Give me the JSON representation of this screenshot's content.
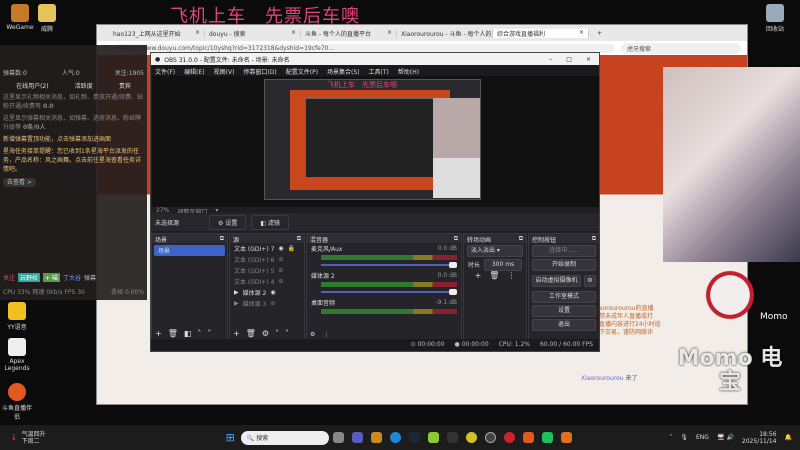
{
  "desktop": {
    "banner": "飞机上车　先票后车噢",
    "icons": [
      "WeGame",
      "威腾",
      "回收站",
      "YY语音",
      "Apex Legends",
      "斗鱼直播伴侣"
    ]
  },
  "browser": {
    "tabs": [
      "hao123_上网从这里开始",
      "douyu - 搜索",
      "斗鱼 - 每个人的直播平台",
      "Xiaorourourou - 斗鱼 - 每个人的直播平台",
      "综合游戏直播福利"
    ],
    "url": "https://www.douyu.com/topic/10yshq?rid=3172318&dyshid=19cfe70...",
    "search": "虎牙搜索",
    "chat_system": "欢迎来到Xiaorourourou的直播间。斗鱼严禁未成年人直播或打赏，依法对直播内容进行24小时巡查。请勿私下交易，谨防网络诈骗。",
    "chat_user": "Xiaorourourou",
    "chat_action": "来了"
  },
  "sidepanel": {
    "stats": [
      "弹幕数:0",
      "人气:0",
      "关注:1905"
    ],
    "tabs": [
      "在线用户(2)",
      "活跃度",
      "贵宾"
    ],
    "msg1": "这里显示礼物相关消息，如礼物、贵族开通/续费、钻粉开通/续费等",
    "count1": "0.0",
    "msg2": "这里显示弹幕相关消息，如弹幕、进房消息、粉丝牌升级等",
    "count2": "0条/0人",
    "notice1": "新增弹幕置顶功能，点击弹幕添加进画面",
    "notice2": "星海任务接单提醒：您已收到1条星海平台派发的任务，产品名称：风之画舞。点击前往星海查看任务详情吧。",
    "go": "去查看 >",
    "tags": [
      "关注",
      "玩野校",
      "+ 喵",
      "丁大谷",
      "弹幕"
    ],
    "perf": "CPU 33%  网速 0kb/s  FPS 30",
    "loss": "丢帧 0.00%"
  },
  "obs": {
    "title": "OBS 31.0.0 - 配置文件: 未命名 - 场景: 未命名",
    "menu": [
      "文件(F)",
      "编辑(E)",
      "视图(V)",
      "停靠窗口(D)",
      "配置文件(P)",
      "场景集合(S)",
      "工具(T)",
      "帮助(H)"
    ],
    "zoom": "27%",
    "zoom_mode": "调整至窗口",
    "no_source": "未选择源",
    "settings_btn": "设置",
    "filters_btn": "滤镜",
    "scenes_title": "场景",
    "scenes": [
      "场景"
    ],
    "sources_title": "源",
    "sources": [
      "文本 (GDI+) 7",
      "文本 (GDI+) 6",
      "文本 (GDI+) 5",
      "文本 (GDI+) 4",
      "媒体源 2",
      "媒体源 3"
    ],
    "mixer_title": "混音器",
    "mixer": [
      {
        "name": "麦克风/Aux",
        "db": "0.0 dB"
      },
      {
        "name": "媒体源 2",
        "db": "0.0 dB"
      },
      {
        "name": "桌面音频",
        "db": "-9.1 dB"
      }
    ],
    "transition_title": "转场动画",
    "transition": "淡入淡出",
    "duration_label": "时长",
    "duration": "300 ms",
    "controls_title": "控制按钮",
    "controls": [
      "连接中......",
      "开始录制",
      "启动虚拟摄像机",
      "工作室模式",
      "设置",
      "退出"
    ],
    "status": {
      "live": "00:00:00",
      "rec": "00:00:00",
      "cpu": "CPU: 1.2%",
      "fps": "60.00 / 60.00 FPS"
    }
  },
  "overlay": {
    "momo": "Momo",
    "momo2": "Momo 电宝"
  },
  "taskbar": {
    "weather": "气温回升",
    "weather2": "下周二",
    "search": "搜索",
    "lang": "ENG",
    "time": "18:56",
    "date": "2025/11/14"
  }
}
